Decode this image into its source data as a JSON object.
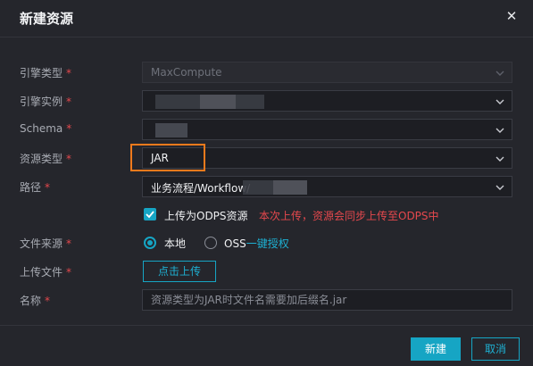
{
  "dialog": {
    "title": "新建资源",
    "close_icon": "close-icon"
  },
  "form": {
    "engine_type": {
      "label": "引擎类型",
      "required": "*",
      "value": "MaxCompute",
      "disabled": true
    },
    "engine_instance": {
      "label": "引擎实例",
      "required": "*",
      "value": ""
    },
    "schema": {
      "label": "Schema",
      "required": "*",
      "value": ""
    },
    "resource_type": {
      "label": "资源类型",
      "required": "*",
      "value": "JAR"
    },
    "path": {
      "label": "路径",
      "required": "*",
      "value": "业务流程/Workflow/"
    },
    "upload_to_odps": {
      "label": "上传为ODPS资源",
      "checked": true,
      "hint": "本次上传，资源会同步上传至ODPS中"
    },
    "file_source": {
      "label": "文件来源",
      "required": "*",
      "options": [
        {
          "label": "本地",
          "selected": true
        },
        {
          "label": "OSS",
          "link": "一键授权",
          "selected": false
        }
      ]
    },
    "upload_file": {
      "label": "上传文件",
      "required": "*",
      "button_label": "点击上传"
    },
    "name": {
      "label": "名称",
      "required": "*",
      "value": "",
      "placeholder": "资源类型为JAR时文件名需要加后缀名.jar"
    }
  },
  "footer": {
    "create_label": "新建",
    "cancel_label": "取消"
  },
  "colors": {
    "accent": "#16a5c4",
    "required": "#e5484d",
    "highlight": "#f07a1c",
    "background": "#25262c"
  }
}
